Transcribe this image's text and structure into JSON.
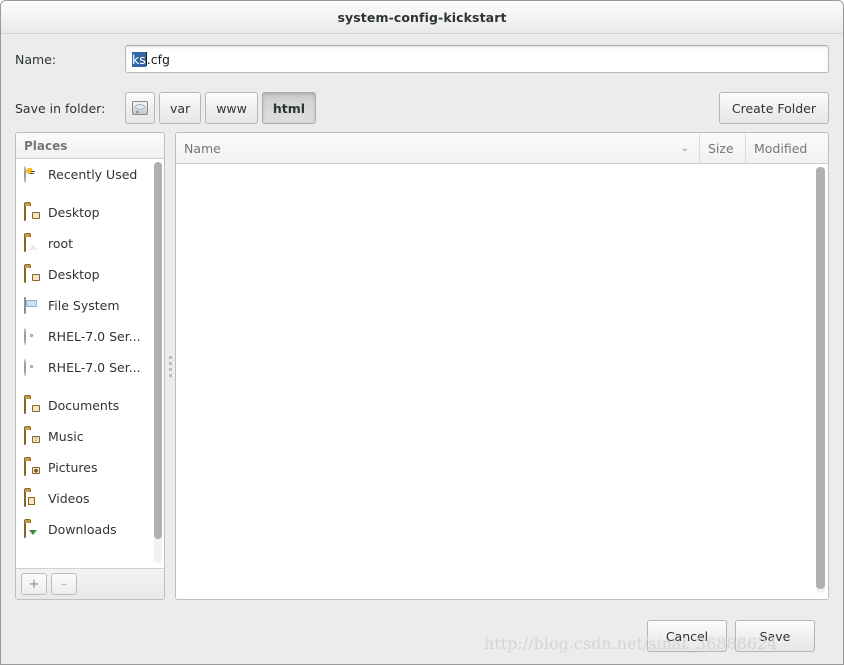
{
  "window": {
    "title": "system-config-kickstart"
  },
  "name_field": {
    "label": "Name:",
    "value": "ks.cfg",
    "selected_text": "ks",
    "remaining_text": ".cfg",
    "selection_color": "#3465a4"
  },
  "folder_row": {
    "label": "Save in folder:",
    "create_folder_label": "Create Folder",
    "path_buttons": [
      {
        "label": "",
        "icon": "drive-icon",
        "active": false
      },
      {
        "label": "var",
        "icon": "",
        "active": false
      },
      {
        "label": "www",
        "icon": "",
        "active": false
      },
      {
        "label": "html",
        "icon": "",
        "active": true
      }
    ]
  },
  "sidebar": {
    "header": "Places",
    "items": [
      {
        "label": "Recently Used",
        "icon": "clock-icon",
        "gap_after": true
      },
      {
        "label": "Desktop",
        "icon": "folder-icon",
        "gap_after": false
      },
      {
        "label": "root",
        "icon": "home-folder-icon",
        "gap_after": false
      },
      {
        "label": "Desktop",
        "icon": "folder-icon",
        "gap_after": false
      },
      {
        "label": "File System",
        "icon": "filesystem-icon",
        "gap_after": false
      },
      {
        "label": "RHEL-7.0 Ser...",
        "icon": "disc-icon",
        "gap_after": false
      },
      {
        "label": "RHEL-7.0 Ser...",
        "icon": "disc-icon",
        "gap_after": true
      },
      {
        "label": "Documents",
        "icon": "folder-icon",
        "gap_after": false
      },
      {
        "label": "Music",
        "icon": "music-folder-icon",
        "gap_after": false
      },
      {
        "label": "Pictures",
        "icon": "pictures-folder-icon",
        "gap_after": false
      },
      {
        "label": "Videos",
        "icon": "videos-folder-icon",
        "gap_after": false
      },
      {
        "label": "Downloads",
        "icon": "downloads-folder-icon",
        "gap_after": false
      }
    ],
    "footer": {
      "add_label": "+",
      "remove_label": "–"
    }
  },
  "file_list": {
    "columns": [
      {
        "label": "Name",
        "sort_indicator": "⌄"
      },
      {
        "label": "Size",
        "sort_indicator": ""
      },
      {
        "label": "Modified",
        "sort_indicator": ""
      }
    ],
    "rows": []
  },
  "actions": {
    "cancel_label": "Cancel",
    "save_label": "Save"
  },
  "watermark": {
    "text": "http://blog.csdn.net/sinat_36888624"
  }
}
